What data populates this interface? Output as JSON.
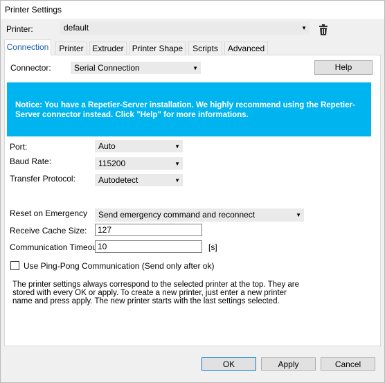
{
  "window": {
    "title": "Printer Settings"
  },
  "printer": {
    "label": "Printer:",
    "selected": "default"
  },
  "tabs": [
    {
      "label": "Connection"
    },
    {
      "label": "Printer"
    },
    {
      "label": "Extruder"
    },
    {
      "label": "Printer Shape"
    },
    {
      "label": "Scripts"
    },
    {
      "label": "Advanced"
    }
  ],
  "connection": {
    "connector_label": "Connector:",
    "connector_value": "Serial Connection",
    "help_label": "Help",
    "notice": "Notice: You have a Repetier-Server installation. We highly recommend using the Repetier-Server connector instead. Click \"Help\" for more informations.",
    "port_label": "Port:",
    "port_value": "Auto",
    "baud_label": "Baud Rate:",
    "baud_value": "115200",
    "protocol_label": "Transfer Protocol:",
    "protocol_value": "Autodetect",
    "reset_label": "Reset on Emergency",
    "reset_value": "Send emergency command and reconnect",
    "cache_label": "Receive Cache Size:",
    "cache_value": "127",
    "timeout_label": "Communication Timeout:",
    "timeout_value": "10",
    "timeout_unit": "[s]",
    "pingpong_label": "Use Ping-Pong Communication (Send only after ok)",
    "info_text": "The printer settings always correspond to the selected printer at the top. They are stored with every OK or apply. To create a new printer, just enter a new printer name and press apply. The new printer starts with the last settings selected."
  },
  "buttons": {
    "ok": "OK",
    "apply": "Apply",
    "cancel": "Cancel"
  },
  "colors": {
    "notice_bg": "#00b4f0",
    "accent": "#0078d7"
  }
}
